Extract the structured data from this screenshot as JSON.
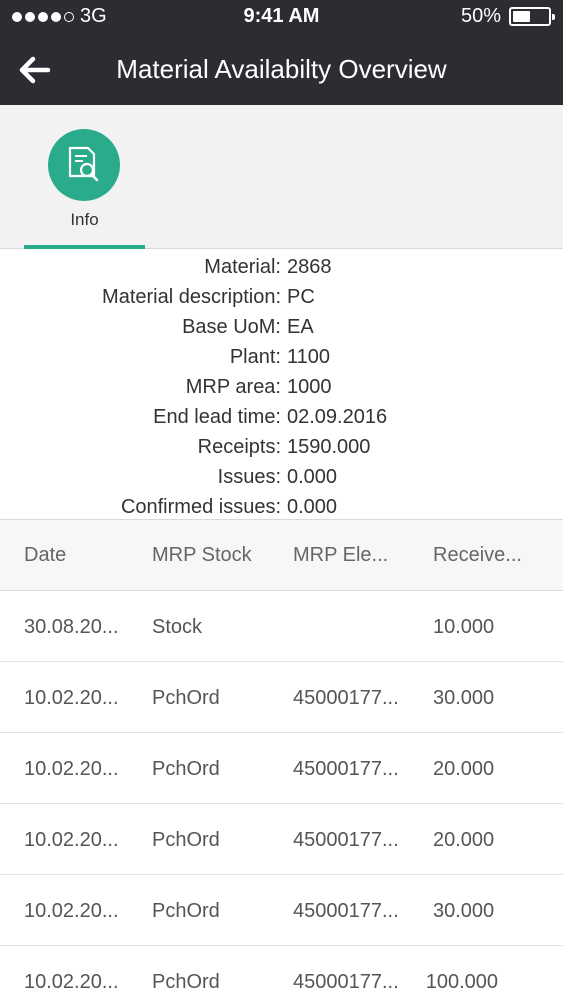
{
  "status_bar": {
    "carrier": "3G",
    "time": "9:41 AM",
    "battery": "50%",
    "battery_level": 0.5
  },
  "header": {
    "title": "Material Availabilty Overview"
  },
  "tabs": [
    {
      "label": "Info",
      "icon": "document-search-icon",
      "selected": true
    }
  ],
  "info": [
    {
      "label": "Material:",
      "value": "2868"
    },
    {
      "label": "Material description:",
      "value": "PC"
    },
    {
      "label": "Base UoM:",
      "value": "EA"
    },
    {
      "label": "Plant:",
      "value": "1100"
    },
    {
      "label": "MRP area:",
      "value": "1000"
    },
    {
      "label": "End lead time:",
      "value": "02.09.2016"
    },
    {
      "label": "Receipts:",
      "value": "1590.000"
    },
    {
      "label": "Issues:",
      "value": "0.000"
    },
    {
      "label": "Confirmed issues:",
      "value": "0.000"
    }
  ],
  "table": {
    "columns": [
      "Date",
      "MRP Stock",
      "MRP Ele...",
      "Receive..."
    ],
    "rows": [
      [
        "30.08.20...",
        "Stock",
        "",
        "10.000"
      ],
      [
        "10.02.20...",
        "PchOrd",
        "45000177...",
        "30.000"
      ],
      [
        "10.02.20...",
        "PchOrd",
        "45000177...",
        "20.000"
      ],
      [
        "10.02.20...",
        "PchOrd",
        "45000177...",
        "20.000"
      ],
      [
        "10.02.20...",
        "PchOrd",
        "45000177...",
        "30.000"
      ],
      [
        "10.02.20...",
        "PchOrd",
        "45000177...",
        "100.000"
      ]
    ]
  },
  "colors": {
    "header_bg": "#2c2c33",
    "accent": "#2aab8c"
  }
}
